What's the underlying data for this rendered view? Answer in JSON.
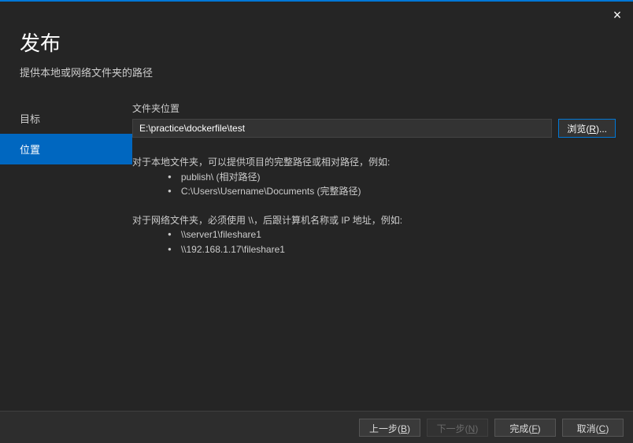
{
  "close": "×",
  "title": "发布",
  "subtitle": "提供本地或网络文件夹的路径",
  "sidebar": {
    "items": [
      {
        "label": "目标"
      },
      {
        "label": "位置"
      }
    ]
  },
  "main": {
    "folderLabel": "文件夹位置",
    "pathValue": "E:\\practice\\dockerfile\\test",
    "browseLabel": "浏览(R)...",
    "help": {
      "line1": "对于本地文件夹，可以提供项目的完整路径或相对路径，例如:",
      "b1": "publish\\ (相对路径)",
      "b2": "C:\\Users\\Username\\Documents (完整路径)",
      "line2": "对于网络文件夹，必须使用 \\\\，后跟计算机名称或 IP 地址，例如:",
      "b3": "\\\\server1\\fileshare1",
      "b4": "\\\\192.168.1.17\\fileshare1"
    }
  },
  "footer": {
    "prev": "上一步(B)",
    "next": "下一步(N)",
    "finish": "完成(F)",
    "cancel": "取消(C)"
  }
}
